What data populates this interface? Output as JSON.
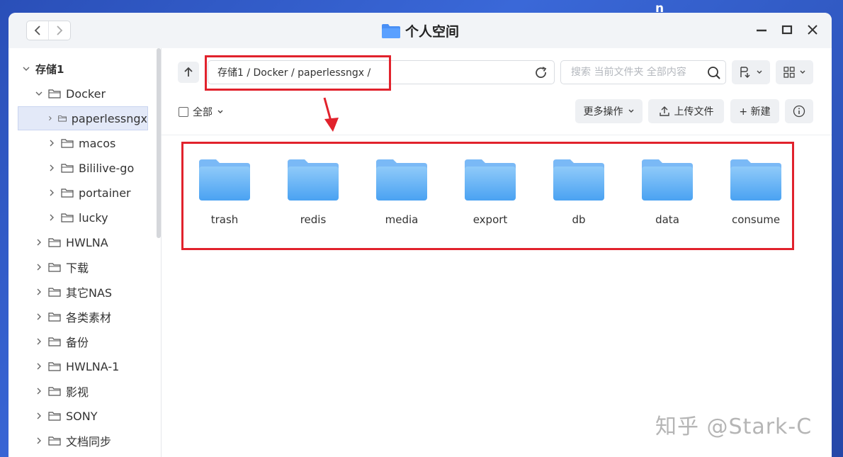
{
  "window": {
    "title": "个人空间"
  },
  "desktop": {
    "corner_glyph": "n"
  },
  "sidebar": {
    "items": [
      {
        "label": "存储1",
        "level": 0,
        "expanded": true,
        "root": true
      },
      {
        "label": "Docker",
        "level": 1,
        "expanded": true
      },
      {
        "label": "paperlessngx",
        "level": 2,
        "selected": true
      },
      {
        "label": "macos",
        "level": 2
      },
      {
        "label": "Bililive-go",
        "level": 2
      },
      {
        "label": "portainer",
        "level": 2
      },
      {
        "label": "lucky",
        "level": 2
      },
      {
        "label": "HWLNA",
        "level": 1
      },
      {
        "label": "下载",
        "level": 1
      },
      {
        "label": "其它NAS",
        "level": 1
      },
      {
        "label": "各类素材",
        "level": 1
      },
      {
        "label": "备份",
        "level": 1
      },
      {
        "label": "HWLNA-1",
        "level": 1
      },
      {
        "label": "影视",
        "level": 1
      },
      {
        "label": "SONY",
        "level": 1
      },
      {
        "label": "文档同步",
        "level": 1
      }
    ]
  },
  "toolbar": {
    "path": "存储1 / Docker / paperlessngx /",
    "search_placeholder": "搜索 当前文件夹 全部内容",
    "select_all_label": "全部",
    "more_actions_label": "更多操作",
    "upload_label": "上传文件",
    "new_label": "+ 新建"
  },
  "folders": [
    {
      "name": "trash"
    },
    {
      "name": "redis"
    },
    {
      "name": "media"
    },
    {
      "name": "export"
    },
    {
      "name": "db"
    },
    {
      "name": "data"
    },
    {
      "name": "consume"
    }
  ],
  "colors": {
    "accent": "#4a90f5",
    "annotation": "#e1222c",
    "folder_top": "#8fcaf9",
    "folder_bottom": "#4aa2f2"
  },
  "watermark": "知乎 @Stark-C"
}
